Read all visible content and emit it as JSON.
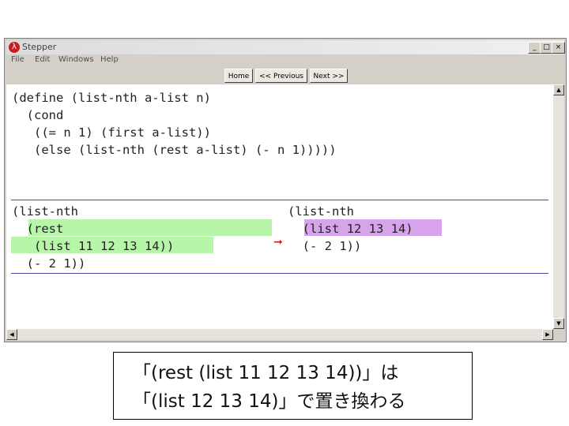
{
  "window": {
    "title": "Stepper",
    "app_icon": "λ",
    "controls": {
      "minimize": "_",
      "maximize": "□",
      "close": "×"
    }
  },
  "menu": [
    "File",
    "Edit",
    "Windows",
    "Help"
  ],
  "toolbar": {
    "home": "Home",
    "previous": "<< Previous",
    "next": "Next >>"
  },
  "definition_lines": [
    "(define (list-nth a-list n)",
    "  (cond",
    "   ((= n 1) (first a-list))",
    "   (else (list-nth (rest a-list) (- n 1)))))"
  ],
  "before_lines": [
    "(list-nth",
    "  (rest",
    "   (list 11 12 13 14))",
    "  (- 2 1))"
  ],
  "after_lines": [
    "(list-nth",
    "  (list 12 13 14)",
    "  (- 2 1))"
  ],
  "highlights": {
    "before_color": "#b7f5a9",
    "after_color": "#d7a3ec",
    "arrow": "➞"
  },
  "scrollbar": {
    "up": "▲",
    "down": "▼",
    "left": "◀",
    "right": "▶"
  },
  "caption": {
    "line1": "「(rest (list 11 12 13 14))」は",
    "line2": "「(list 12 13 14)」で置き換わる"
  }
}
